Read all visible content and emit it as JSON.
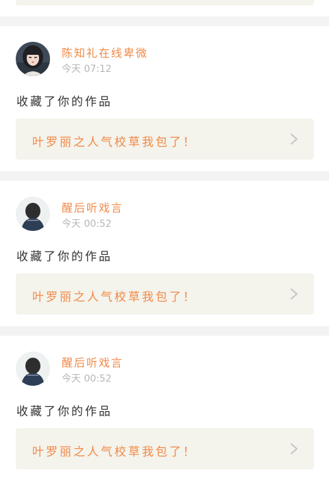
{
  "colors": {
    "accent": "#f08a48",
    "muted": "#b6b6b6",
    "text": "#333333",
    "work_box_bg": "#f4f3ec",
    "page_bg": "#f3f3f3"
  },
  "feed": [
    {
      "username": "陈知礼在线卑微",
      "time": "今天 07:12",
      "action": "收藏了你的作品",
      "work_title": "叶罗丽之人气校草我包了！",
      "avatar_icon": "girl-avatar-icon",
      "chevron_icon": "chevron-right-icon"
    },
    {
      "username": "醒后听戏言",
      "time": "今天 00:52",
      "action": "收藏了你的作品",
      "work_title": "叶罗丽之人气校草我包了！",
      "avatar_icon": "back-view-avatar-icon",
      "chevron_icon": "chevron-right-icon"
    },
    {
      "username": "醒后听戏言",
      "time": "今天 00:52",
      "action": "收藏了你的作品",
      "work_title": "叶罗丽之人气校草我包了！",
      "avatar_icon": "back-view-avatar-icon",
      "chevron_icon": "chevron-right-icon"
    }
  ]
}
